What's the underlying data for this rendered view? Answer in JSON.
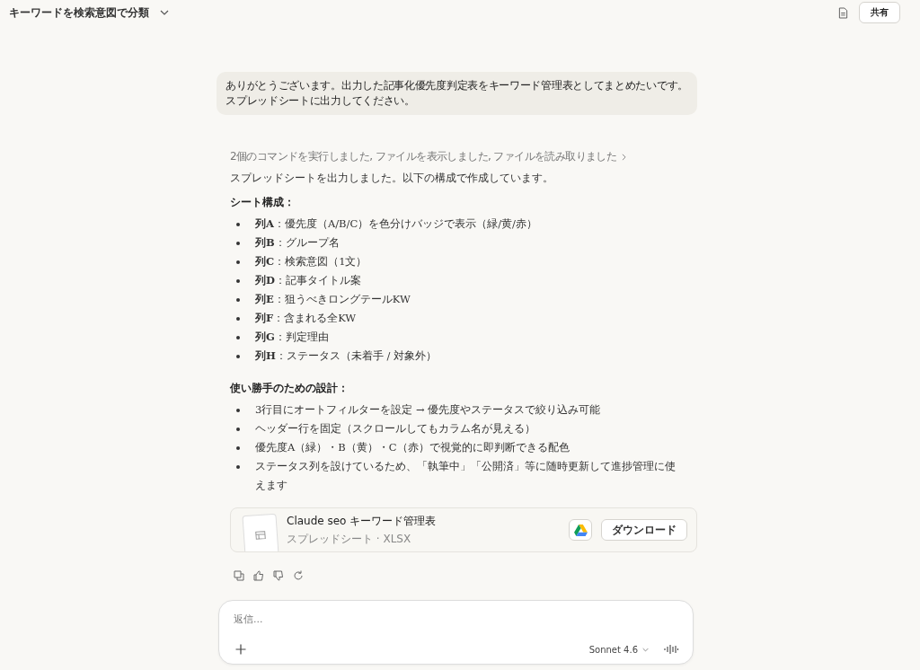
{
  "header": {
    "title": "キーワードを検索意図で分類",
    "share_button": "共有"
  },
  "user_message": {
    "lines": [
      "ありがとうございます。出力した記事化優先度判定表をキーワード管理表としてまとめたいです。",
      "スプレッドシートに出力してください。"
    ]
  },
  "tool_summary": "2個のコマンドを実行しました, ファイルを表示しました, ファイルを読み取りました",
  "response": {
    "intro": "スプレッドシートを出力しました。以下の構成で作成しています。",
    "sections": [
      {
        "heading": "シート構成：",
        "items": [
          "**列A**：優先度（A/B/C）を色分けバッジで表示（緑/黄/赤）",
          "**列B**：グループ名",
          "**列C**：検索意図（1文）",
          "**列D**：記事タイトル案",
          "**列E**：狙うべきロングテールKW",
          "**列F**：含まれる全KW",
          "**列G**：判定理由",
          "**列H**：ステータス（未着手 / 対象外）"
        ]
      },
      {
        "heading": "使い勝手のための設計：",
        "items": [
          "3行目にオートフィルターを設定 → 優先度やステータスで絞り込み可能",
          "ヘッダー行を固定（スクロールしてもカラム名が見える）",
          "優先度A（緑）・B（黄）・C（赤）で視覚的に即判断できる配色",
          "ステータス列を設けているため、「執筆中」「公開済」等に随時更新して進捗管理に使えます"
        ]
      }
    ]
  },
  "file_card": {
    "name": "Claude seo キーワード管理表",
    "meta": "スプレッドシート · XLSX",
    "download_button": "ダウンロード"
  },
  "composer": {
    "placeholder": "返信...",
    "model": "Sonnet 4.6"
  }
}
